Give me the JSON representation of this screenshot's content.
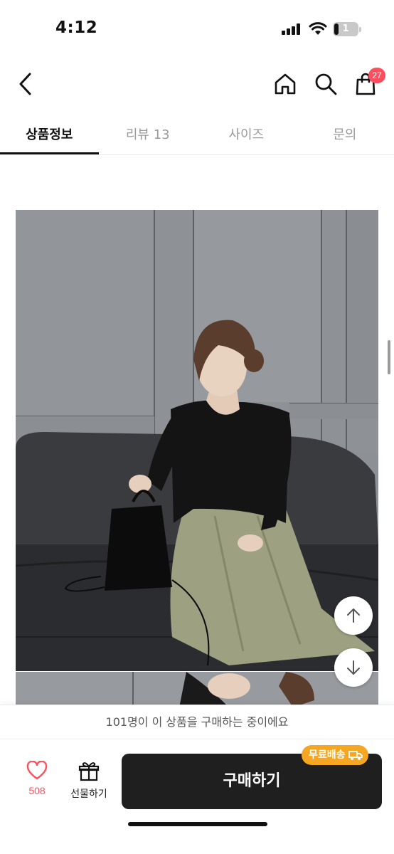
{
  "status_bar": {
    "time": "4:12",
    "battery_level": "1"
  },
  "header": {
    "icons": [
      "chevron-left-icon",
      "home-icon",
      "search-icon",
      "cart-icon"
    ],
    "cart_count": "27"
  },
  "tabs": [
    {
      "label": "상품정보",
      "active": true
    },
    {
      "label": "리뷰 13",
      "active": false
    },
    {
      "label": "사이즈",
      "active": false
    },
    {
      "label": "문의",
      "active": false
    }
  ],
  "product_image": {
    "icon": "product-photo"
  },
  "scroll_buttons": {
    "up_icon": "arrow-up-icon",
    "down_icon": "arrow-down-icon"
  },
  "notice": {
    "text": "101명이 이 상품을 구매하는 중이에요"
  },
  "bottom_bar": {
    "like_count": "508",
    "gift_label": "선물하기",
    "buy_label": "구매하기",
    "shipping_badge": "무료배송"
  },
  "colors": {
    "accent_red": "#ff4f5e",
    "badge_orange": "#f5a623",
    "buy_button": "#1f1f1f"
  }
}
